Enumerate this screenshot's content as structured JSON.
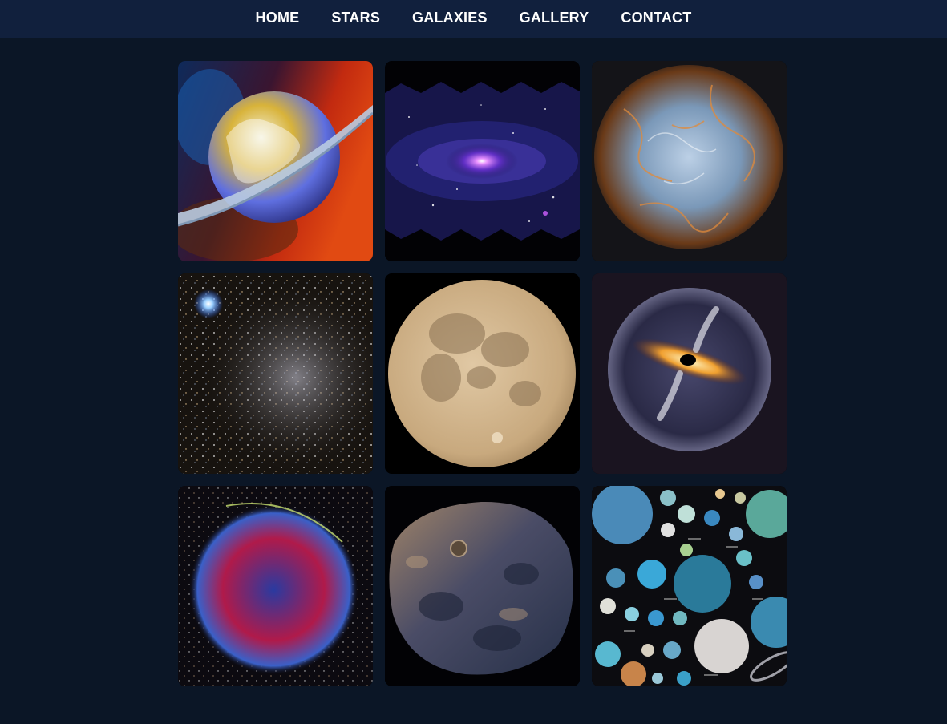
{
  "nav": {
    "items": [
      "HOME",
      "STARS",
      "GALAXIES",
      "GALLERY",
      "CONTACT"
    ]
  },
  "gallery": {
    "images": [
      {
        "name": "ringed-planet-image"
      },
      {
        "name": "spiral-galaxy-image"
      },
      {
        "name": "nebula-image"
      },
      {
        "name": "star-cluster-image"
      },
      {
        "name": "moon-image"
      },
      {
        "name": "black-hole-image"
      },
      {
        "name": "supernova-remnant-image"
      },
      {
        "name": "asteroid-image"
      },
      {
        "name": "exoplanets-collage-image"
      }
    ]
  }
}
